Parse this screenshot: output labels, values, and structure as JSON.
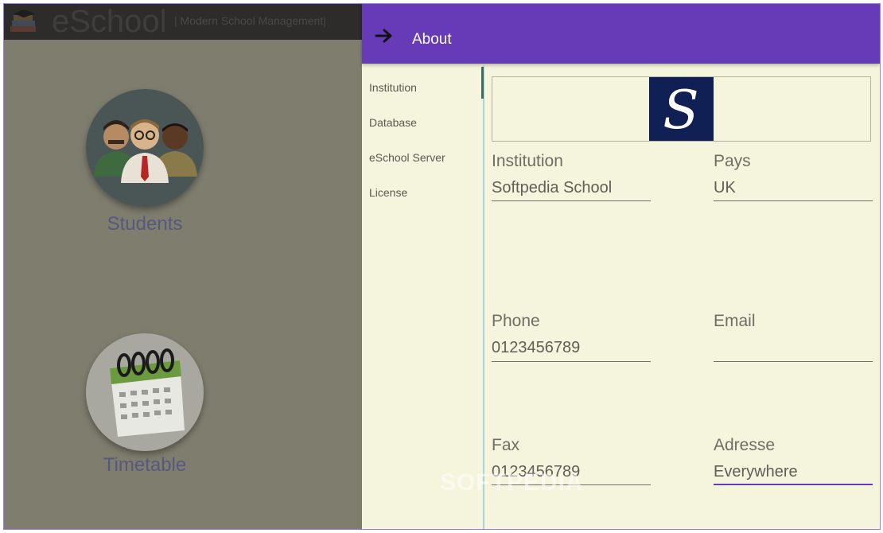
{
  "app": {
    "title": "eSchool",
    "subtitle": "| Modern School Management|"
  },
  "tiles": [
    {
      "label": "Students",
      "icon": "students-icon"
    },
    {
      "label": "Timetable",
      "icon": "calendar-icon"
    }
  ],
  "about": {
    "header_title": "About",
    "back_icon": "arrow-right-icon",
    "accent_color": "#673ab7",
    "nav": [
      {
        "label": "Institution",
        "active": true
      },
      {
        "label": "Database"
      },
      {
        "label": "eSchool Server"
      },
      {
        "label": "License"
      }
    ],
    "logo": {
      "letter": "S",
      "background": "#112054"
    },
    "fields": {
      "institution": {
        "label": "Institution",
        "value": "Softpedia School"
      },
      "pays": {
        "label": "Pays",
        "value": "UK"
      },
      "phone": {
        "label": "Phone",
        "value": "0123456789"
      },
      "email": {
        "label": "Email",
        "value": ""
      },
      "fax": {
        "label": "Fax",
        "value": "0123456789"
      },
      "adresse": {
        "label": "Adresse",
        "value": "Everywhere"
      }
    }
  },
  "watermark": "SOFTPEDIA"
}
